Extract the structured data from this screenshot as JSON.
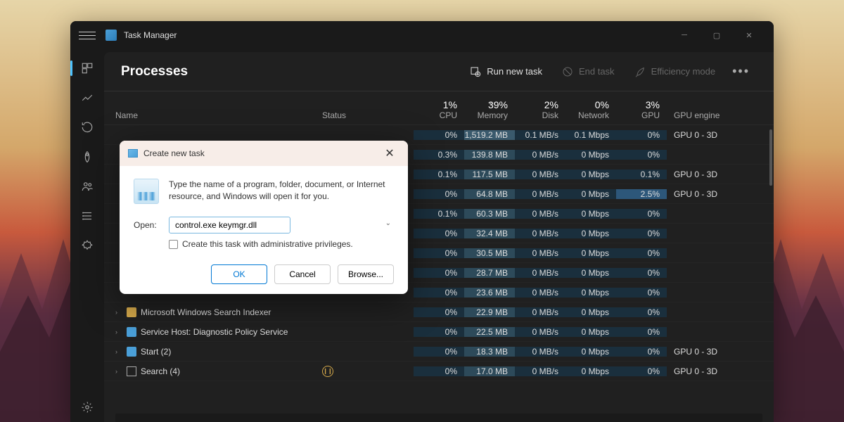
{
  "app": {
    "title": "Task Manager"
  },
  "toolbar": {
    "page_title": "Processes",
    "run_new_task": "Run new task",
    "end_task": "End task",
    "efficiency_mode": "Efficiency mode"
  },
  "columns": {
    "name": "Name",
    "status": "Status",
    "cpu": {
      "pct": "1%",
      "label": "CPU"
    },
    "memory": {
      "pct": "39%",
      "label": "Memory"
    },
    "disk": {
      "pct": "2%",
      "label": "Disk"
    },
    "network": {
      "pct": "0%",
      "label": "Network"
    },
    "gpu": {
      "pct": "3%",
      "label": "GPU"
    },
    "gpu_engine": "GPU engine"
  },
  "rows": [
    {
      "name": "",
      "cpu": "0%",
      "mem": "1,519.2 MB",
      "disk": "0.1 MB/s",
      "net": "0.1 Mbps",
      "gpu": "0%",
      "eng": "GPU 0 - 3D",
      "mem_high": true
    },
    {
      "name": "",
      "cpu": "0.3%",
      "mem": "139.8 MB",
      "disk": "0 MB/s",
      "net": "0 Mbps",
      "gpu": "0%",
      "eng": ""
    },
    {
      "name": "",
      "cpu": "0.1%",
      "mem": "117.5 MB",
      "disk": "0 MB/s",
      "net": "0 Mbps",
      "gpu": "0.1%",
      "eng": "GPU 0 - 3D"
    },
    {
      "name": "",
      "cpu": "0%",
      "mem": "64.8 MB",
      "disk": "0 MB/s",
      "net": "0 Mbps",
      "gpu": "2.5%",
      "eng": "GPU 0 - 3D",
      "gpu_bright": true
    },
    {
      "name": "",
      "cpu": "0.1%",
      "mem": "60.3 MB",
      "disk": "0 MB/s",
      "net": "0 Mbps",
      "gpu": "0%",
      "eng": ""
    },
    {
      "name": "",
      "cpu": "0%",
      "mem": "32.4 MB",
      "disk": "0 MB/s",
      "net": "0 Mbps",
      "gpu": "0%",
      "eng": ""
    },
    {
      "name": "",
      "cpu": "0%",
      "mem": "30.5 MB",
      "disk": "0 MB/s",
      "net": "0 Mbps",
      "gpu": "0%",
      "eng": ""
    },
    {
      "name": "",
      "cpu": "0%",
      "mem": "28.7 MB",
      "disk": "0 MB/s",
      "net": "0 Mbps",
      "gpu": "0%",
      "eng": ""
    },
    {
      "name": "",
      "cpu": "0%",
      "mem": "23.6 MB",
      "disk": "0 MB/s",
      "net": "0 Mbps",
      "gpu": "0%",
      "eng": ""
    },
    {
      "name": "Microsoft Windows Search Indexer",
      "cpu": "0%",
      "mem": "22.9 MB",
      "disk": "0 MB/s",
      "net": "0 Mbps",
      "gpu": "0%",
      "eng": "",
      "expand": true,
      "icon": "search-indexer"
    },
    {
      "name": "Service Host: Diagnostic Policy Service",
      "cpu": "0%",
      "mem": "22.5 MB",
      "disk": "0 MB/s",
      "net": "0 Mbps",
      "gpu": "0%",
      "eng": "",
      "expand": true,
      "icon": "service-host"
    },
    {
      "name": "Start (2)",
      "cpu": "0%",
      "mem": "18.3 MB",
      "disk": "0 MB/s",
      "net": "0 Mbps",
      "gpu": "0%",
      "eng": "GPU 0 - 3D",
      "expand": true,
      "icon": "start"
    },
    {
      "name": "Search (4)",
      "cpu": "0%",
      "mem": "17.0 MB",
      "disk": "0 MB/s",
      "net": "0 Mbps",
      "gpu": "0%",
      "eng": "GPU 0 - 3D",
      "expand": true,
      "icon": "search",
      "paused": true
    }
  ],
  "dialog": {
    "title": "Create new task",
    "description": "Type the name of a program, folder, document, or Internet resource, and Windows will open it for you.",
    "open_label": "Open:",
    "input_value": "control.exe keymgr.dll",
    "admin_check": "Create this task with administrative privileges.",
    "ok": "OK",
    "cancel": "Cancel",
    "browse": "Browse..."
  }
}
